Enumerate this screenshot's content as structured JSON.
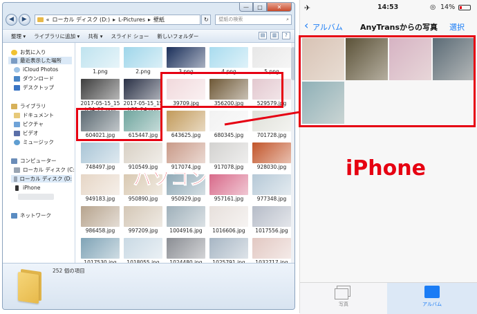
{
  "explorer": {
    "window_buttons": [
      "—",
      "□",
      "✕"
    ],
    "address_path": [
      "«",
      "ローカル ディスク (D:)",
      "▸",
      "L-Pictures",
      "▸",
      "壁紙"
    ],
    "search_placeholder": "壁紙の検索",
    "toolbar": [
      "整理 ▾",
      "ライブラリに追加 ▾",
      "共有 ▾",
      "スライド ショー",
      "新しいフォルダー"
    ],
    "nav": {
      "favorites_header": "お気に入り",
      "favorites": [
        "最近表示した場所",
        "iCloud Photos",
        "ダウンロード",
        "デスクトップ"
      ],
      "libraries_header": "ライブラリ",
      "libraries": [
        "ドキュメント",
        "ピクチャ",
        "ビデオ",
        "ミュージック"
      ],
      "computer_header": "コンピューター",
      "computer": [
        "ローカル ディスク (C:",
        "ローカル ディスク (D:",
        "iPhone"
      ],
      "network_header": "ネットワーク"
    },
    "files": [
      {
        "name": "1.png",
        "color": "#bfe3ef"
      },
      {
        "name": "2.png",
        "color": "#9fd6ea"
      },
      {
        "name": "3.png",
        "color": "#1a2f5a"
      },
      {
        "name": "4.png",
        "color": "#a9dcef"
      },
      {
        "name": "5.png",
        "color": "#e7e7e7"
      },
      {
        "name": "2017-05-15_15",
        "name2": "h34_22.png",
        "color": "#3e3e3e"
      },
      {
        "name": "2017-05-15_15",
        "name2": "h35_24.png",
        "color": "#2a3146"
      },
      {
        "name": "39709.jpg",
        "color": "#f1d9dc"
      },
      {
        "name": "356200.jpg",
        "color": "#6e5836"
      },
      {
        "name": "529579.jpg",
        "color": "#e3c8cf"
      },
      {
        "name": "604021.jpg",
        "color": "#5c6a72"
      },
      {
        "name": "615447.jpg",
        "color": "#6fa59e"
      },
      {
        "name": "643625.jpg",
        "color": "#c29a5a"
      },
      {
        "name": "680345.jpg",
        "color": "#f2f2f2"
      },
      {
        "name": "701728.jpg",
        "color": "#dfe0d8"
      },
      {
        "name": "748497.jpg",
        "color": "#a9c5d6"
      },
      {
        "name": "910549.jpg",
        "color": "#d8d0c4"
      },
      {
        "name": "917074.jpg",
        "color": "#c99a88"
      },
      {
        "name": "917078.jpg",
        "color": "#d3d2d0"
      },
      {
        "name": "928030.jpg",
        "color": "#c2552a"
      },
      {
        "name": "949183.jpg",
        "color": "#e6d6c6"
      },
      {
        "name": "950890.jpg",
        "color": "#d9c9b2"
      },
      {
        "name": "950929.jpg",
        "color": "#8fa9b6"
      },
      {
        "name": "957161.jpg",
        "color": "#d86a8a"
      },
      {
        "name": "977348.jpg",
        "color": "#b6c9d7"
      },
      {
        "name": "986458.jpg",
        "color": "#b7a48e"
      },
      {
        "name": "997209.jpg",
        "color": "#d4c7b6"
      },
      {
        "name": "1004916.jpg",
        "color": "#9fb0ba"
      },
      {
        "name": "1016606.jpg",
        "color": "#e7e0dc"
      },
      {
        "name": "1017556.jpg",
        "color": "#b6bcc8"
      },
      {
        "name": "1017530.jpg",
        "color": "#7fa3b6"
      },
      {
        "name": "1018055.jpg",
        "color": "#c9d9e4"
      },
      {
        "name": "1024480.jpg",
        "color": "#8a8d93"
      },
      {
        "name": "1025791.jpg",
        "color": "#a7b6c4"
      },
      {
        "name": "1032717.jpg",
        "color": "#e2c8c2"
      }
    ],
    "status_text": "252 個の項目"
  },
  "labels": {
    "pasokon": "パソコン",
    "iphone": "iPhone"
  },
  "iphone": {
    "time": "14:53",
    "battery": "14%",
    "back_label": "アルバム",
    "title": "AnyTransからの写真",
    "select_label": "選択",
    "photos": [
      "#d8c3b5",
      "#5b5238",
      "#d6b3c3",
      "#5b6b76",
      "#8fb0b7"
    ],
    "tabs": [
      "写真",
      "アルバム"
    ]
  }
}
